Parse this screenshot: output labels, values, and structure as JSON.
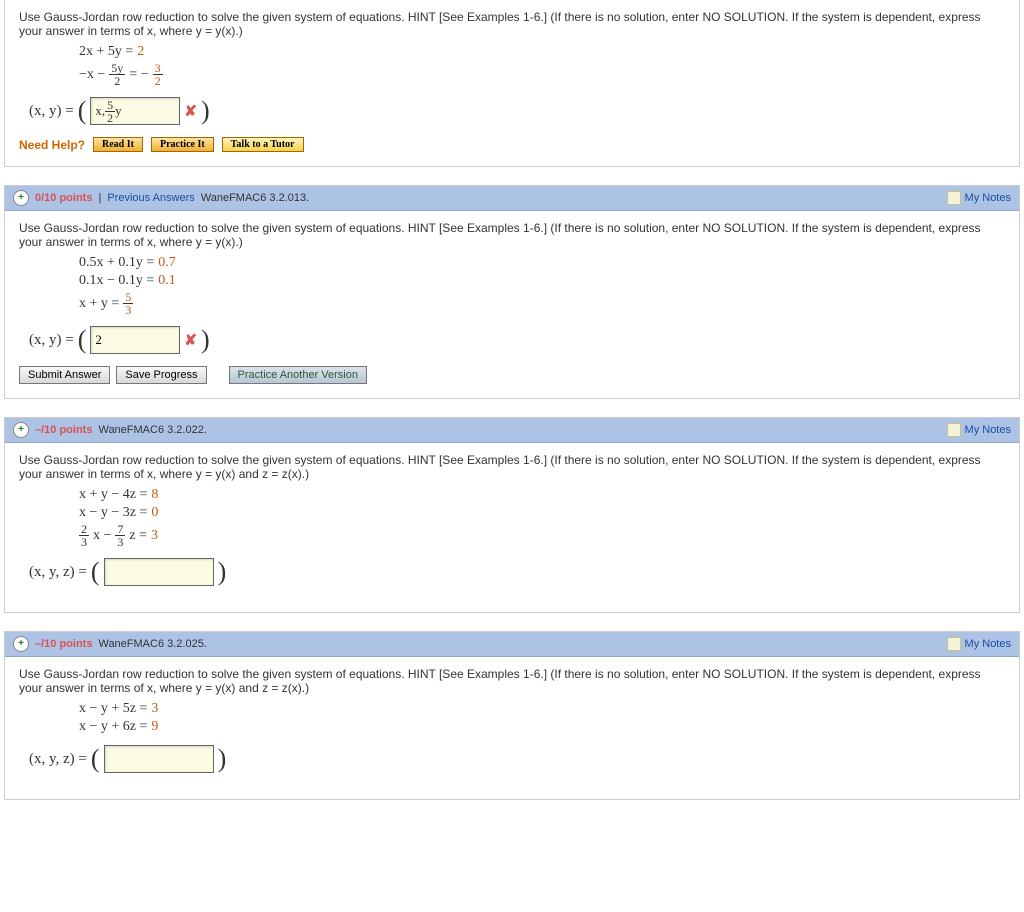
{
  "q1": {
    "prompt": "Use Gauss-Jordan row reduction to solve the given system of equations. HINT [See Examples 1-6.] (If there is no solution, enter NO SOLUTION. If the system is dependent, express your answer in terms of x, where  y = y(x).)",
    "eq1_l": "2x  +  5y  = ",
    "eq1_c": "2",
    "eq2_a": "−x  −",
    "eq2_fn": "5y",
    "eq2_fd": "2",
    "eq2_mid": " = −",
    "eq2_rn": "3",
    "eq2_rd": "2",
    "answer_label": "(x, y) = ",
    "answer_value": "x, ",
    "answer_frac_n": "5",
    "answer_frac_d": "2",
    "answer_suffix": "y",
    "need_help": "Need Help?",
    "readit": "Read It",
    "practice": "Practice It",
    "tutor": "Talk to a Tutor"
  },
  "q2": {
    "points": "0/10 points",
    "prev": "Previous Answers",
    "ref": "WaneFMAC6 3.2.013.",
    "notes": "My Notes",
    "prompt": "Use Gauss-Jordan row reduction to solve the given system of equations. HINT [See Examples 1-6.] (If there is no solution, enter NO SOLUTION. If the system is dependent, express your answer in terms of x, where  y = y(x).)",
    "eq1": "0.5x  +  0.1y  = ",
    "eq1c": "0.7",
    "eq2": "0.1x  −  0.1y  = ",
    "eq2c": "0.1",
    "eq3_l": "x  +      y  = ",
    "eq3_n": "5",
    "eq3_d": "3",
    "answer_label": "(x, y) = ",
    "answer_value": "2",
    "submit": "Submit Answer",
    "save": "Save Progress",
    "another": "Practice Another Version"
  },
  "q3": {
    "points": "–/10 points",
    "ref": "WaneFMAC6 3.2.022.",
    "notes": "My Notes",
    "prompt": "Use Gauss-Jordan row reduction to solve the given system of equations. HINT [See Examples 1-6.] (If there is no solution, enter NO SOLUTION. If the system is dependent, express your answer in terms of x, where  y = y(x)  and  z = z(x).)",
    "eq1": "x  +  y  −  4z  = ",
    "eq1c": "8",
    "eq2": "x  −  y  −  3z  = ",
    "eq2c": "0",
    "eq3_an": "2",
    "eq3_ad": "3",
    "eq3_mid": "x         −",
    "eq3_bn": "7",
    "eq3_bd": "3",
    "eq3_end": "z  = ",
    "eq3c": "3",
    "answer_label": "(x, y, z) = "
  },
  "q4": {
    "points": "–/10 points",
    "ref": "WaneFMAC6 3.2.025.",
    "notes": "My Notes",
    "prompt": "Use Gauss-Jordan row reduction to solve the given system of equations. HINT [See Examples 1-6.] (If there is no solution, enter NO SOLUTION. If the system is dependent, express your answer in terms of x, where  y = y(x)  and  z = z(x).)",
    "eq1": "x  −  y  +  5z  = ",
    "eq1c": "3",
    "eq2": "x  −  y  +  6z  = ",
    "eq2c": "9",
    "answer_label": "(x, y, z) = "
  }
}
